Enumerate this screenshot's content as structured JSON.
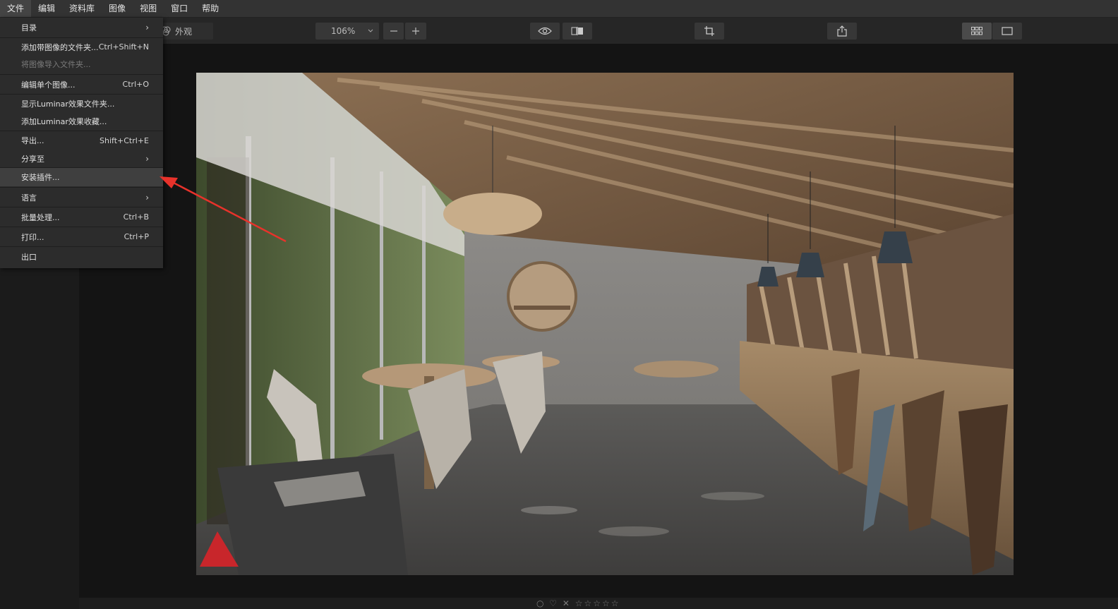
{
  "menubar": {
    "items": [
      "文件",
      "编辑",
      "资料库",
      "图像",
      "视图",
      "窗口",
      "帮助"
    ]
  },
  "toolbar": {
    "appearance_label": "外观",
    "zoom_value": "106%"
  },
  "file_menu": {
    "items": [
      {
        "label": "目录",
        "shortcut": "",
        "submenu": true
      },
      {
        "label": "添加带图像的文件夹...",
        "shortcut": "Ctrl+Shift+N",
        "submenu": false
      },
      {
        "label": "将图像导入文件夹...",
        "shortcut": "",
        "submenu": false,
        "disabled": true
      },
      {
        "label": "编辑单个图像...",
        "shortcut": "Ctrl+O",
        "submenu": false
      },
      {
        "label": "显示Luminar效果文件夹...",
        "shortcut": "",
        "submenu": false
      },
      {
        "label": "添加Luminar效果收藏...",
        "shortcut": "",
        "submenu": false
      },
      {
        "label": "导出...",
        "shortcut": "Shift+Ctrl+E",
        "submenu": false
      },
      {
        "label": "分享至",
        "shortcut": "",
        "submenu": true
      },
      {
        "label": "安装插件...",
        "shortcut": "",
        "submenu": false,
        "highlighted": true
      },
      {
        "label": "语言",
        "shortcut": "",
        "submenu": true
      },
      {
        "label": "批量处理...",
        "shortcut": "Ctrl+B",
        "submenu": false
      },
      {
        "label": "打印...",
        "shortcut": "Ctrl+P",
        "submenu": false
      },
      {
        "label": "出口",
        "shortcut": "",
        "submenu": false
      }
    ]
  },
  "icons": {
    "chevron": "chevron-right-icon",
    "zoom_out": "minus-icon",
    "zoom_in": "plus-icon",
    "eye": "eye-icon",
    "compare": "compare-icon",
    "crop": "crop-icon",
    "share": "share-icon",
    "grid": "grid-icon",
    "single": "single-view-icon"
  },
  "colors": {
    "menubar_bg": "#333333",
    "menu_bg": "#2c2c2c",
    "highlight": "#3f3f3f",
    "annotation_arrow": "#e8322b"
  }
}
